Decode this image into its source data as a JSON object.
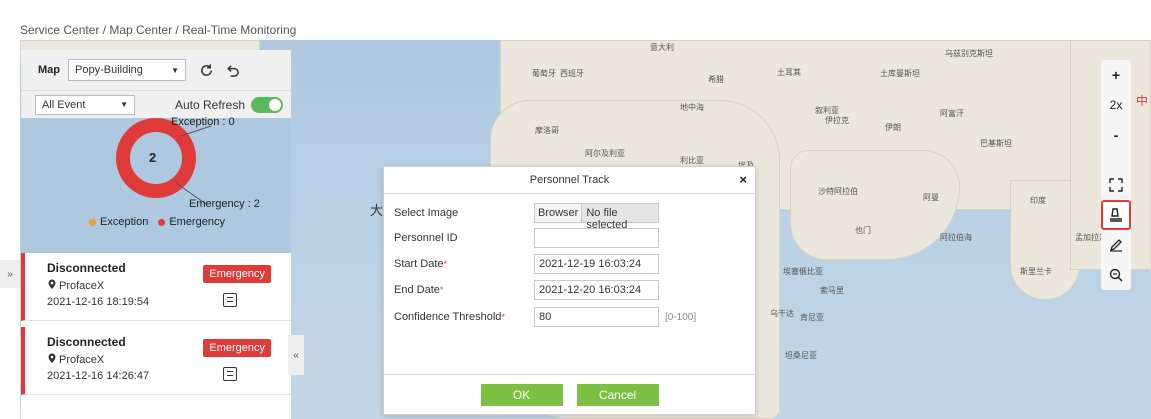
{
  "breadcrumb": "Service Center / Map Center / Real-Time Monitoring",
  "panel": {
    "map_label": "Map",
    "map_select": "Popy-Building",
    "event_select": "All Event",
    "auto_refresh_label": "Auto Refresh",
    "auto_refresh_on": true
  },
  "chart_data": {
    "type": "pie",
    "center_value": "2",
    "labels": [
      "Exception : 0",
      "Emergency : 2"
    ],
    "legend": [
      "Exception",
      "Emergency"
    ],
    "slices": [
      {
        "name": "Exception",
        "value": 0,
        "color": "#f0a030"
      },
      {
        "name": "Emergency",
        "value": 2,
        "color": "#e03b3b"
      }
    ]
  },
  "alarms": [
    {
      "status": "Disconnected",
      "device": "ProfaceX",
      "time": "2021-12-16 18:19:54",
      "badge": "Emergency"
    },
    {
      "status": "Disconnected",
      "device": "ProfaceX",
      "time": "2021-12-16 14:26:47",
      "badge": "Emergency"
    }
  ],
  "toolbar": {
    "zoom_in": "+",
    "zoom_level": "2x",
    "zoom_out": "-"
  },
  "dialog": {
    "title": "Personnel Track",
    "close": "×",
    "select_image_label": "Select Image",
    "browse_button": "Browser",
    "file_status": "No file selected",
    "personnel_id_label": "Personnel ID",
    "personnel_id_value": "",
    "start_date_label": "Start Date",
    "start_date_value": "2021-12-19 16:03:24",
    "end_date_label": "End Date",
    "end_date_value": "2021-12-20 16:03:24",
    "confidence_label": "Confidence Threshold",
    "confidence_value": "80",
    "confidence_range": "[0-100]",
    "required_mark": "*",
    "ok": "OK",
    "cancel": "Cancel"
  },
  "map_labels": [
    "意大利",
    "葡萄牙",
    "西班牙",
    "希腊",
    "土耳其",
    "土库曼斯坦",
    "乌兹别克斯坦",
    "地中海",
    "叙利亚",
    "伊拉克",
    "伊朗",
    "阿富汗",
    "摩洛哥",
    "阿尔及利亚",
    "利比亚",
    "埃及",
    "巴基斯坦",
    "沙特阿拉伯",
    "阿曼",
    "印度",
    "也门",
    "阿拉伯海",
    "孟加拉湾",
    "埃塞俄比亚",
    "索马里",
    "乌干达",
    "肯尼亚",
    "坦桑尼亚",
    "斯里兰卡",
    "中",
    "大西洋"
  ]
}
